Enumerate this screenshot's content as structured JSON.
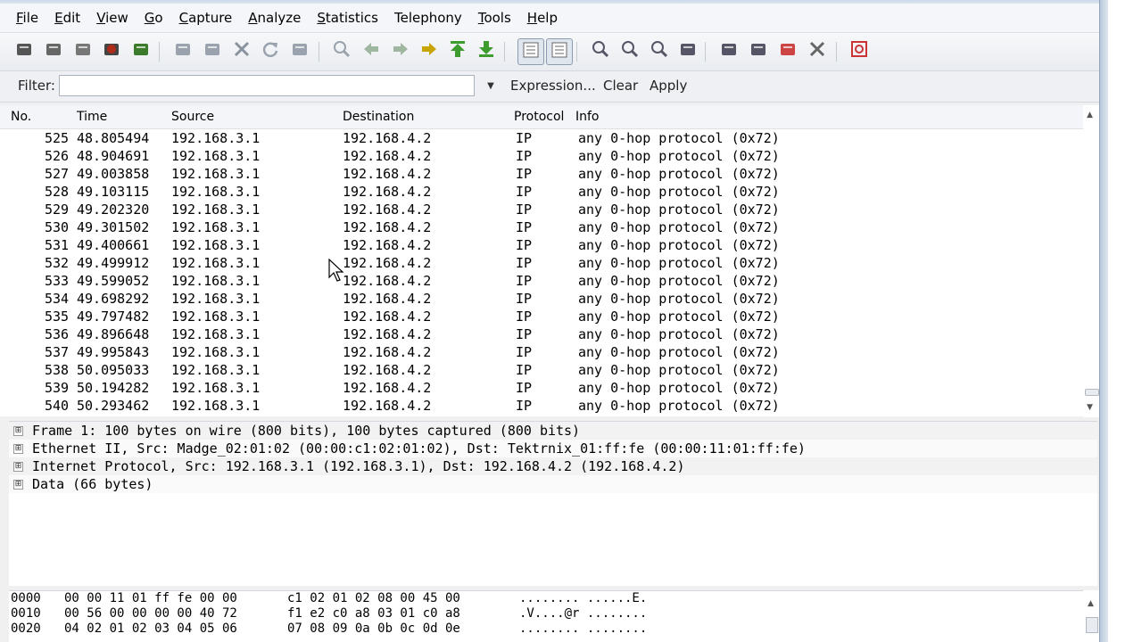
{
  "menu": [
    {
      "acc": "F",
      "rest": "ile"
    },
    {
      "acc": "E",
      "rest": "dit"
    },
    {
      "acc": "V",
      "rest": "iew"
    },
    {
      "acc": "G",
      "rest": "o"
    },
    {
      "acc": "C",
      "rest": "apture"
    },
    {
      "acc": "A",
      "rest": "nalyze"
    },
    {
      "acc": "S",
      "rest": "tatistics"
    },
    {
      "acc": "",
      "rest": "Telephony"
    },
    {
      "acc": "T",
      "rest": "ools"
    },
    {
      "acc": "H",
      "rest": "elp"
    }
  ],
  "toolbar": {
    "icons": [
      "interface-list-icon",
      "capture-options-icon",
      "start-capture-icon",
      "stop-capture-icon",
      "restart-capture-icon",
      "open-file-icon",
      "save-file-icon",
      "close-file-icon",
      "reload-icon",
      "print-icon",
      "find-packet-icon",
      "go-back-icon",
      "go-forward-icon",
      "go-to-packet-icon",
      "go-first-icon",
      "go-last-icon",
      "colorize-icon",
      "auto-scroll-icon",
      "zoom-in-icon",
      "zoom-out-icon",
      "zoom-normal-icon",
      "resize-columns-icon",
      "capture-filters-icon",
      "display-filters-icon",
      "coloring-rules-icon",
      "preferences-icon",
      "help-icon"
    ]
  },
  "filter": {
    "label": "Filter:",
    "value": "",
    "expression": "Expression...",
    "clear": "Clear",
    "apply": "Apply"
  },
  "packet_list": {
    "columns": {
      "no": "No.",
      "time": "Time",
      "source": "Source",
      "destination": "Destination",
      "protocol": "Protocol",
      "info": "Info"
    },
    "rows": [
      {
        "no": "525",
        "time": "48.805494",
        "src": "192.168.3.1",
        "dst": "192.168.4.2",
        "proto": "IP",
        "info": "any 0-hop protocol (0x72)"
      },
      {
        "no": "526",
        "time": "48.904691",
        "src": "192.168.3.1",
        "dst": "192.168.4.2",
        "proto": "IP",
        "info": "any 0-hop protocol (0x72)"
      },
      {
        "no": "527",
        "time": "49.003858",
        "src": "192.168.3.1",
        "dst": "192.168.4.2",
        "proto": "IP",
        "info": "any 0-hop protocol (0x72)"
      },
      {
        "no": "528",
        "time": "49.103115",
        "src": "192.168.3.1",
        "dst": "192.168.4.2",
        "proto": "IP",
        "info": "any 0-hop protocol (0x72)"
      },
      {
        "no": "529",
        "time": "49.202320",
        "src": "192.168.3.1",
        "dst": "192.168.4.2",
        "proto": "IP",
        "info": "any 0-hop protocol (0x72)"
      },
      {
        "no": "530",
        "time": "49.301502",
        "src": "192.168.3.1",
        "dst": "192.168.4.2",
        "proto": "IP",
        "info": "any 0-hop protocol (0x72)"
      },
      {
        "no": "531",
        "time": "49.400661",
        "src": "192.168.3.1",
        "dst": "192.168.4.2",
        "proto": "IP",
        "info": "any 0-hop protocol (0x72)"
      },
      {
        "no": "532",
        "time": "49.499912",
        "src": "192.168.3.1",
        "dst": "192.168.4.2",
        "proto": "IP",
        "info": "any 0-hop protocol (0x72)"
      },
      {
        "no": "533",
        "time": "49.599052",
        "src": "192.168.3.1",
        "dst": "192.168.4.2",
        "proto": "IP",
        "info": "any 0-hop protocol (0x72)"
      },
      {
        "no": "534",
        "time": "49.698292",
        "src": "192.168.3.1",
        "dst": "192.168.4.2",
        "proto": "IP",
        "info": "any 0-hop protocol (0x72)"
      },
      {
        "no": "535",
        "time": "49.797482",
        "src": "192.168.3.1",
        "dst": "192.168.4.2",
        "proto": "IP",
        "info": "any 0-hop protocol (0x72)"
      },
      {
        "no": "536",
        "time": "49.896648",
        "src": "192.168.3.1",
        "dst": "192.168.4.2",
        "proto": "IP",
        "info": "any 0-hop protocol (0x72)"
      },
      {
        "no": "537",
        "time": "49.995843",
        "src": "192.168.3.1",
        "dst": "192.168.4.2",
        "proto": "IP",
        "info": "any 0-hop protocol (0x72)"
      },
      {
        "no": "538",
        "time": "50.095033",
        "src": "192.168.3.1",
        "dst": "192.168.4.2",
        "proto": "IP",
        "info": "any 0-hop protocol (0x72)"
      },
      {
        "no": "539",
        "time": "50.194282",
        "src": "192.168.3.1",
        "dst": "192.168.4.2",
        "proto": "IP",
        "info": "any 0-hop protocol (0x72)"
      },
      {
        "no": "540",
        "time": "50.293462",
        "src": "192.168.3.1",
        "dst": "192.168.4.2",
        "proto": "IP",
        "info": "any 0-hop protocol (0x72)"
      }
    ]
  },
  "details": [
    "Frame 1: 100 bytes on wire (800 bits), 100 bytes captured (800 bits)",
    "Ethernet II, Src: Madge_02:01:02 (00:00:c1:02:01:02), Dst: Tektrnix_01:ff:fe (00:00:11:01:ff:fe)",
    "Internet Protocol, Src: 192.168.3.1 (192.168.3.1), Dst: 192.168.4.2 (192.168.4.2)",
    "Data (66 bytes)"
  ],
  "details_expander": "⊞",
  "bytes": [
    {
      "offset": "0000",
      "hex1": "00 00 11 01 ff fe 00 00",
      "hex2": "c1 02 01 02 08 00 45 00",
      "ascii": "........ ......E."
    },
    {
      "offset": "0010",
      "hex1": "00 56 00 00 00 00 40 72",
      "hex2": "f1 e2 c0 a8 03 01 c0 a8",
      "ascii": ".V....@r ........"
    },
    {
      "offset": "0020",
      "hex1": "04 02 01 02 03 04 05 06",
      "hex2": "07 08 09 0a 0b 0c 0d 0e",
      "ascii": "........ ........"
    }
  ]
}
